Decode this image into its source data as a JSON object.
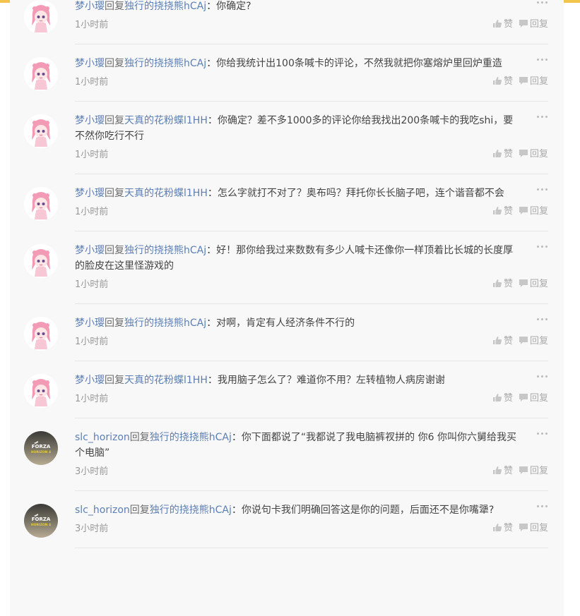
{
  "ui": {
    "accent": "#f3c54c",
    "name_color": "#5b7fb5",
    "reply_word": "回复",
    "separator": "：",
    "like_label": "赞",
    "reply_label": "回复"
  },
  "comments": [
    {
      "avatar": "anime-girl-avatar",
      "user": "梦小璎",
      "target": "独行的挠挠熊hCAj",
      "text": "你确定?",
      "time": "1小时前"
    },
    {
      "avatar": "anime-girl-avatar",
      "user": "梦小璎",
      "target": "独行的挠挠熊hCAj",
      "text": "你给我统计出100条喊卡的评论，不然我就把你塞熔炉里回炉重造",
      "time": "1小时前"
    },
    {
      "avatar": "anime-girl-avatar",
      "user": "梦小璎",
      "target": "天真的花粉蝶l1HH",
      "text": "你确定？差不多1000多的评论你给我找出200条喊卡的我吃shi，要不然你吃行不行",
      "time": "1小时前"
    },
    {
      "avatar": "anime-girl-avatar",
      "user": "梦小璎",
      "target": "天真的花粉蝶l1HH",
      "text": "怎么字就打不对了？奥布吗？拜托你长长脑子吧，连个谐音都不会",
      "time": "1小时前"
    },
    {
      "avatar": "anime-girl-avatar",
      "user": "梦小璎",
      "target": "独行的挠挠熊hCAj",
      "text": "好！那你给我过来数数有多少人喊卡还像你一样顶着比长城的长度厚的脸皮在这里怪游戏的",
      "time": "1小时前"
    },
    {
      "avatar": "anime-girl-avatar",
      "user": "梦小璎",
      "target": "独行的挠挠熊hCAj",
      "text": "对啊，肯定有人经济条件不行的",
      "time": "1小时前"
    },
    {
      "avatar": "anime-girl-avatar",
      "user": "梦小璎",
      "target": "天真的花粉蝶l1HH",
      "text": "我用脑子怎么了？难道你不用？左转植物人病房谢谢",
      "time": "1小时前"
    },
    {
      "avatar": "forza-horizon-avatar",
      "user": "slc_horizon",
      "target": "独行的挠挠熊hCAj",
      "text": "你下面都说了“我都说了我电脑裤衩拼的 你6 你叫你六舅给我买个电脑”",
      "time": "3小时前",
      "logo_line1": "FORZA",
      "logo_line2": "HORIZON 4"
    },
    {
      "avatar": "forza-horizon-avatar",
      "user": "slc_horizon",
      "target": "独行的挠挠熊hCAj",
      "text": "你说句卡我们明确回答这是你的问题，后面还不是你嘴犟?",
      "time": "3小时前",
      "logo_line1": "FORZA",
      "logo_line2": "HORIZON 4"
    }
  ]
}
